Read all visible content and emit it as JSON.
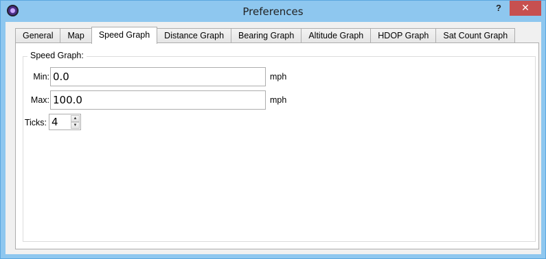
{
  "window": {
    "title": "Preferences",
    "help_label": "?",
    "close_label": "✕"
  },
  "tabs": [
    {
      "label": "General"
    },
    {
      "label": "Map"
    },
    {
      "label": "Speed Graph",
      "active": true
    },
    {
      "label": "Distance Graph"
    },
    {
      "label": "Bearing Graph"
    },
    {
      "label": "Altitude Graph"
    },
    {
      "label": "HDOP Graph"
    },
    {
      "label": "Sat Count Graph"
    }
  ],
  "speed_graph": {
    "group_title": "Speed Graph:",
    "min": {
      "label": "Min:",
      "value": "0.0",
      "unit": "mph"
    },
    "max": {
      "label": "Max:",
      "value": "100.0",
      "unit": "mph"
    },
    "ticks": {
      "label": "Ticks:",
      "value": "4",
      "up": "▲",
      "down": "▼"
    }
  }
}
